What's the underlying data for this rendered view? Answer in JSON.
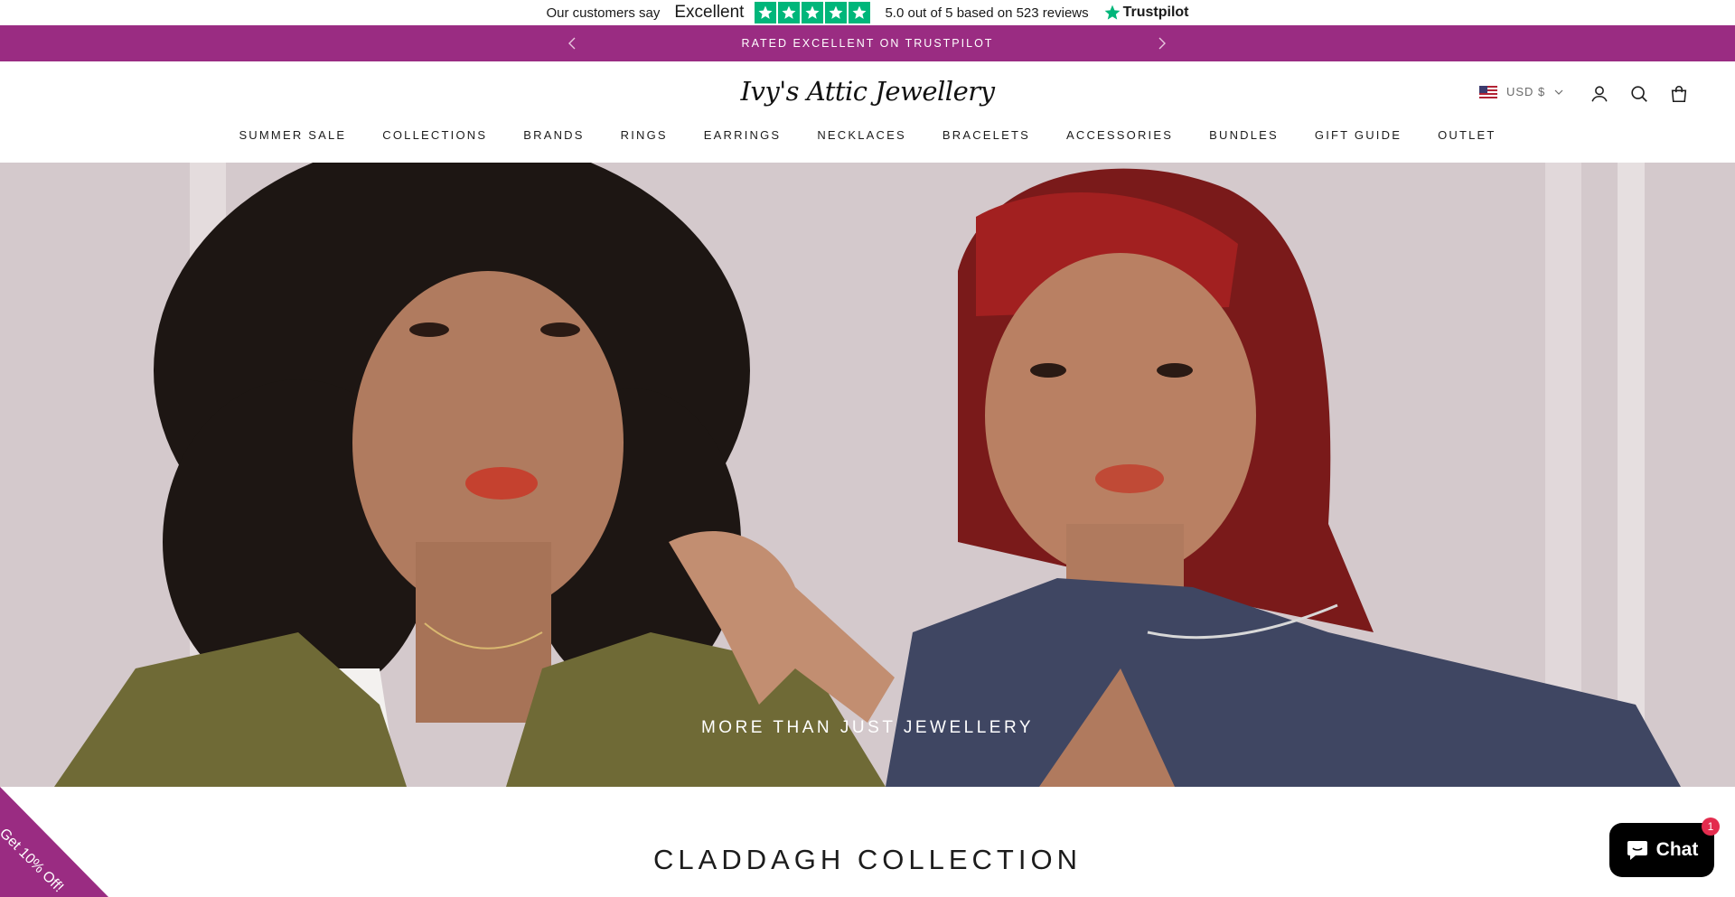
{
  "trustpilot": {
    "prefix": "Our customers say",
    "rating_word": "Excellent",
    "score_text": "5.0 out of 5 based on 523 reviews",
    "brand": "Trustpilot",
    "stars": 5,
    "star_color": "#00b67a"
  },
  "announcement": {
    "text": "RATED EXCELLENT ON TRUSTPILOT",
    "background": "#9a2c82",
    "prev_icon": "chevron-left-icon",
    "next_icon": "chevron-right-icon"
  },
  "header": {
    "logo": "Ivy's Attic Jewellery",
    "currency": "USD $",
    "icons": [
      "account-icon",
      "search-icon",
      "bag-icon"
    ]
  },
  "nav": {
    "items": [
      "SUMMER SALE",
      "COLLECTIONS",
      "BRANDS",
      "RINGS",
      "EARRINGS",
      "NECKLACES",
      "BRACELETS",
      "ACCESSORIES",
      "BUNDLES",
      "GIFT GUIDE",
      "OUTLET"
    ]
  },
  "hero": {
    "tagline": "MORE THAN JUST JEWELLERY"
  },
  "section": {
    "title": "CLADDAGH COLLECTION"
  },
  "discount_tab": {
    "label": "Get 10% Off!",
    "color": "#9a2c82"
  },
  "chat": {
    "label": "Chat",
    "badge": "1"
  }
}
